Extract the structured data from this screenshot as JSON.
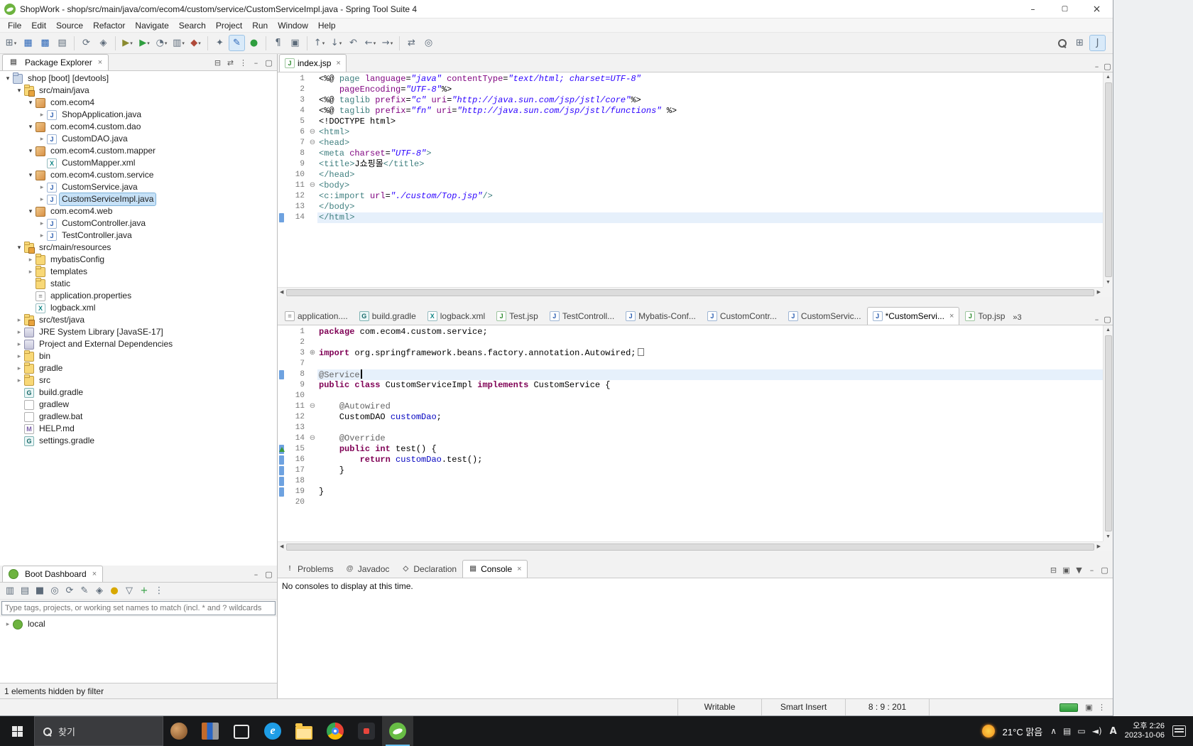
{
  "window": {
    "title": "ShopWork - shop/src/main/java/com/ecom4/custom/service/CustomServiceImpl.java - Spring Tool Suite 4"
  },
  "menu": [
    "File",
    "Edit",
    "Source",
    "Refactor",
    "Navigate",
    "Search",
    "Project",
    "Run",
    "Window",
    "Help"
  ],
  "toolbar": {
    "groups": [
      [
        {
          "n": "new",
          "g": "⊞",
          "caret": true
        },
        {
          "n": "save",
          "g": "▦",
          "c": "g-blue"
        },
        {
          "n": "save-all",
          "g": "▩",
          "c": "g-blue"
        },
        {
          "n": "print",
          "g": "▤"
        }
      ],
      [
        {
          "n": "refresh",
          "g": "⟳"
        },
        {
          "n": "build-all",
          "g": "◈"
        }
      ],
      [
        {
          "n": "debug",
          "g": "▶",
          "c": "g-olive",
          "caret": true
        },
        {
          "n": "run",
          "g": "▶",
          "c": "g-green",
          "caret": true
        },
        {
          "n": "profile",
          "g": "◔",
          "caret": true
        },
        {
          "n": "coverage",
          "g": "▥",
          "caret": true
        },
        {
          "n": "external-tools",
          "g": "◆",
          "c": "g-red",
          "caret": true
        }
      ],
      [
        {
          "n": "new-wizard",
          "g": "✦"
        },
        {
          "n": "mark-occurrences",
          "g": "✎",
          "c": "g-blue",
          "active": true
        },
        {
          "n": "boot-dashboard",
          "g": "●",
          "c": "g-green"
        }
      ],
      [
        {
          "n": "show-whitespace",
          "g": "¶"
        },
        {
          "n": "block-selection",
          "g": "▣"
        }
      ],
      [
        {
          "n": "previous-annotation",
          "g": "↑",
          "caret": true
        },
        {
          "n": "next-annotation",
          "g": "↓",
          "caret": true
        },
        {
          "n": "last-edit-location",
          "g": "↶"
        },
        {
          "n": "back",
          "g": "←",
          "caret": true
        },
        {
          "n": "forward",
          "g": "→",
          "caret": true
        }
      ],
      [
        {
          "n": "link-with-editor",
          "g": "⇄"
        },
        {
          "n": "open-type",
          "g": "◎"
        }
      ]
    ],
    "right": [
      {
        "n": "search"
      },
      {
        "n": "open-perspective",
        "g": "⊞"
      },
      {
        "n": "java-perspective",
        "g": "J",
        "active": true
      }
    ]
  },
  "package_explorer": {
    "title": "Package Explorer",
    "header_icons": [
      {
        "n": "collapse-all",
        "g": "⊟"
      },
      {
        "n": "link-with-editor",
        "g": "⇄"
      },
      {
        "n": "view-menu",
        "g": "⋮"
      },
      {
        "n": "minimize",
        "g": "–"
      },
      {
        "n": "maximize",
        "g": "▢"
      }
    ],
    "tree": [
      {
        "d": 0,
        "a": "o",
        "i": "project",
        "l": "shop [boot] [devtools]"
      },
      {
        "d": 1,
        "a": "o",
        "i": "srcfolder",
        "l": "src/main/java"
      },
      {
        "d": 2,
        "a": "o",
        "i": "package",
        "l": "com.ecom4"
      },
      {
        "d": 3,
        "a": "c",
        "i": "javafile",
        "l": "ShopApplication.java"
      },
      {
        "d": 2,
        "a": "o",
        "i": "package",
        "l": "com.ecom4.custom.dao"
      },
      {
        "d": 3,
        "a": "c",
        "i": "javafile",
        "l": "CustomDAO.java"
      },
      {
        "d": 2,
        "a": "o",
        "i": "package",
        "l": "com.ecom4.custom.mapper"
      },
      {
        "d": 3,
        "i": "xmlfile",
        "l": "CustomMapper.xml"
      },
      {
        "d": 2,
        "a": "o",
        "i": "package",
        "l": "com.ecom4.custom.service"
      },
      {
        "d": 3,
        "a": "c",
        "i": "javafile",
        "l": "CustomService.java"
      },
      {
        "d": 3,
        "a": "c",
        "i": "javafile",
        "l": "CustomServiceImpl.java",
        "sel": true
      },
      {
        "d": 2,
        "a": "o",
        "i": "package",
        "l": "com.ecom4.web"
      },
      {
        "d": 3,
        "a": "c",
        "i": "javafile",
        "l": "CustomController.java"
      },
      {
        "d": 3,
        "a": "c",
        "i": "javafile",
        "l": "TestController.java"
      },
      {
        "d": 1,
        "a": "o",
        "i": "srcfolder",
        "l": "src/main/resources"
      },
      {
        "d": 2,
        "a": "c",
        "i": "folder",
        "l": "mybatisConfig"
      },
      {
        "d": 2,
        "a": "c",
        "i": "folder",
        "l": "templates"
      },
      {
        "d": 2,
        "i": "folder",
        "l": "static"
      },
      {
        "d": 2,
        "i": "propsfile",
        "l": "application.properties"
      },
      {
        "d": 2,
        "i": "xmlfile",
        "l": "logback.xml"
      },
      {
        "d": 1,
        "a": "c",
        "i": "srcfolder",
        "l": "src/test/java"
      },
      {
        "d": 1,
        "a": "c",
        "i": "library",
        "l": "JRE System Library [JavaSE-17]"
      },
      {
        "d": 1,
        "a": "c",
        "i": "library",
        "l": "Project and External Dependencies"
      },
      {
        "d": 1,
        "a": "c",
        "i": "folder",
        "l": "bin"
      },
      {
        "d": 1,
        "a": "c",
        "i": "folder",
        "l": "gradle"
      },
      {
        "d": 1,
        "a": "c",
        "i": "folder",
        "l": "src"
      },
      {
        "d": 1,
        "i": "gradlefile",
        "l": "build.gradle"
      },
      {
        "d": 1,
        "i": "file",
        "l": "gradlew"
      },
      {
        "d": 1,
        "i": "file",
        "l": "gradlew.bat"
      },
      {
        "d": 1,
        "i": "mdfile",
        "l": "HELP.md"
      },
      {
        "d": 1,
        "i": "gradlefile",
        "l": "settings.gradle"
      }
    ]
  },
  "boot_dashboard": {
    "title": "Boot Dashboard",
    "header_icons": [
      {
        "n": "minimize",
        "g": "–"
      },
      {
        "n": "maximize",
        "g": "▢"
      }
    ],
    "toolbar": [
      {
        "n": "start",
        "g": "▥"
      },
      {
        "n": "start-debug",
        "g": "▤"
      },
      {
        "n": "stop",
        "g": "■"
      },
      {
        "n": "open-web-browser",
        "g": "◎"
      },
      {
        "n": "refresh",
        "g": "⟳"
      },
      {
        "n": "edit-config",
        "g": "✎"
      },
      {
        "n": "tag",
        "g": "◈"
      },
      {
        "n": "tips",
        "g": "●",
        "c": "g-yel"
      },
      {
        "n": "filter",
        "g": "▽"
      },
      {
        "n": "add",
        "g": "+",
        "c": "g-green"
      },
      {
        "n": "view-menu",
        "g": "⋮"
      }
    ],
    "filter_placeholder": "Type tags, projects, or working set names to match (incl. * and ? wildcards",
    "items": [
      {
        "label": "local"
      }
    ],
    "footer": "1 elements hidden by filter"
  },
  "editors": {
    "top": {
      "tabs": [
        {
          "i": "jsp",
          "l": "index.jsp",
          "active": true,
          "close": true
        }
      ],
      "lines": [
        {
          "n": 1,
          "s": [
            [
              "p",
              "<%@ "
            ],
            [
              "t",
              "page"
            ],
            [
              "p",
              " "
            ],
            [
              "a",
              "language"
            ],
            [
              "p",
              "="
            ],
            [
              "s",
              "\"java\""
            ],
            [
              "p",
              " "
            ],
            [
              "a",
              "contentType"
            ],
            [
              "p",
              "="
            ],
            [
              "s",
              "\"text/html; charset=UTF-8\""
            ]
          ]
        },
        {
          "n": 2,
          "s": [
            [
              "p",
              "    "
            ],
            [
              "a",
              "pageEncoding"
            ],
            [
              "p",
              "="
            ],
            [
              "s",
              "\"UTF-8\""
            ],
            [
              "p",
              "%>"
            ]
          ]
        },
        {
          "n": 3,
          "s": [
            [
              "p",
              "<%@ "
            ],
            [
              "t",
              "taglib"
            ],
            [
              "p",
              " "
            ],
            [
              "a",
              "prefix"
            ],
            [
              "p",
              "="
            ],
            [
              "s",
              "\"c\""
            ],
            [
              "p",
              " "
            ],
            [
              "a",
              "uri"
            ],
            [
              "p",
              "="
            ],
            [
              "s",
              "\"http://java.sun.com/jsp/jstl/core\""
            ],
            [
              "p",
              "%>"
            ]
          ]
        },
        {
          "n": 4,
          "s": [
            [
              "p",
              "<%@ "
            ],
            [
              "t",
              "taglib"
            ],
            [
              "p",
              " "
            ],
            [
              "a",
              "prefix"
            ],
            [
              "p",
              "="
            ],
            [
              "s",
              "\"fn\""
            ],
            [
              "p",
              " "
            ],
            [
              "a",
              "uri"
            ],
            [
              "p",
              "="
            ],
            [
              "s",
              "\"http://java.sun.com/jsp/jstl/functions\""
            ],
            [
              "p",
              " %>"
            ]
          ]
        },
        {
          "n": 5,
          "s": [
            [
              "p",
              "<!DOCTYPE html>"
            ]
          ]
        },
        {
          "n": 6,
          "f": "-",
          "s": [
            [
              "t",
              "<html>"
            ]
          ]
        },
        {
          "n": 7,
          "f": "-",
          "s": [
            [
              "t",
              "<head>"
            ]
          ]
        },
        {
          "n": 8,
          "s": [
            [
              "t",
              "<meta "
            ],
            [
              "a",
              "charset"
            ],
            [
              "p",
              "="
            ],
            [
              "s",
              "\"UTF-8\""
            ],
            [
              "t",
              ">"
            ]
          ]
        },
        {
          "n": 9,
          "s": [
            [
              "t",
              "<title>"
            ],
            [
              "p",
              "J쇼핑몰"
            ],
            [
              "t",
              "</title>"
            ]
          ]
        },
        {
          "n": 10,
          "s": [
            [
              "t",
              "</head>"
            ]
          ]
        },
        {
          "n": 11,
          "f": "-",
          "s": [
            [
              "t",
              "<body>"
            ]
          ]
        },
        {
          "n": 12,
          "s": [
            [
              "t",
              "<c:import "
            ],
            [
              "a",
              "url"
            ],
            [
              "p",
              "="
            ],
            [
              "s",
              "\"./custom/Top.jsp\""
            ],
            [
              "t",
              "/>"
            ]
          ]
        },
        {
          "n": 13,
          "s": [
            [
              "t",
              "</body>"
            ]
          ]
        },
        {
          "n": 14,
          "m": true,
          "h": true,
          "s": [
            [
              "t",
              "</html>"
            ]
          ]
        }
      ]
    },
    "bottom": {
      "tabs": [
        {
          "i": "propsfile",
          "l": "application...."
        },
        {
          "i": "gradlefile",
          "l": "build.gradle"
        },
        {
          "i": "xmlfile",
          "l": "logback.xml"
        },
        {
          "i": "jsp",
          "l": "Test.jsp"
        },
        {
          "i": "javafile",
          "l": "TestControll..."
        },
        {
          "i": "javafile",
          "l": "Mybatis-Conf..."
        },
        {
          "i": "javafile",
          "l": "CustomContr..."
        },
        {
          "i": "javafile",
          "l": "CustomServic..."
        },
        {
          "i": "javafile",
          "l": "*CustomServi...",
          "active": true,
          "close": true
        },
        {
          "i": "jsp",
          "l": "Top.jsp"
        }
      ],
      "overflow": "»3",
      "lines": [
        {
          "n": 1,
          "s": [
            [
              "k",
              "package"
            ],
            [
              "p",
              " com.ecom4.custom.service;"
            ]
          ]
        },
        {
          "n": 2,
          "s": []
        },
        {
          "n": 3,
          "f": "+",
          "s": [
            [
              "k",
              "import"
            ],
            [
              "p",
              " org.springframework.beans.factory.annotation.Autowired;"
            ],
            [
              "bx",
              ""
            ]
          ]
        },
        {
          "n": 7,
          "s": []
        },
        {
          "n": 8,
          "h": true,
          "m": true,
          "s": [
            [
              "an",
              "@Service"
            ],
            [
              "cur",
              ""
            ]
          ]
        },
        {
          "n": 9,
          "s": [
            [
              "k",
              "public"
            ],
            [
              "p",
              " "
            ],
            [
              "k",
              "class"
            ],
            [
              "p",
              " CustomServiceImpl "
            ],
            [
              "k",
              "implements"
            ],
            [
              "p",
              " CustomService {"
            ]
          ]
        },
        {
          "n": 10,
          "s": []
        },
        {
          "n": 11,
          "f": "-",
          "s": [
            [
              "p",
              "    "
            ],
            [
              "an",
              "@Autowired"
            ]
          ]
        },
        {
          "n": 12,
          "s": [
            [
              "p",
              "    CustomDAO "
            ],
            [
              "fd",
              "customDao"
            ],
            [
              "p",
              ";"
            ]
          ]
        },
        {
          "n": 13,
          "s": []
        },
        {
          "n": 14,
          "f": "-",
          "s": [
            [
              "p",
              "    "
            ],
            [
              "an",
              "@Override"
            ]
          ]
        },
        {
          "n": 15,
          "m": true,
          "t": true,
          "s": [
            [
              "p",
              "    "
            ],
            [
              "k",
              "public"
            ],
            [
              "p",
              " "
            ],
            [
              "k",
              "int"
            ],
            [
              "p",
              " test() {"
            ]
          ]
        },
        {
          "n": 16,
          "m": true,
          "s": [
            [
              "p",
              "        "
            ],
            [
              "k",
              "return"
            ],
            [
              "p",
              " "
            ],
            [
              "fd",
              "customDao"
            ],
            [
              "p",
              ".test();"
            ]
          ]
        },
        {
          "n": 17,
          "m": true,
          "s": [
            [
              "p",
              "    }"
            ]
          ]
        },
        {
          "n": 18,
          "m": true,
          "s": []
        },
        {
          "n": 19,
          "m": true,
          "s": [
            [
              "p",
              "}"
            ]
          ]
        },
        {
          "n": 20,
          "s": []
        }
      ]
    }
  },
  "console": {
    "tabs": [
      {
        "i": "problems",
        "l": "Problems"
      },
      {
        "i": "at",
        "l": "Javadoc"
      },
      {
        "i": "decl",
        "l": "Declaration"
      },
      {
        "i": "console",
        "l": "Console",
        "active": true,
        "close": true
      }
    ],
    "right_icons": [
      {
        "n": "pin-console",
        "g": "⊟"
      },
      {
        "n": "display-selected-console",
        "g": "▣"
      },
      {
        "n": "open-console",
        "g": "▼"
      },
      {
        "n": "minimize",
        "g": "–"
      },
      {
        "n": "maximize",
        "g": "▢"
      }
    ],
    "message": "No consoles to display at this time."
  },
  "statusbar": {
    "cells": [
      "Writable",
      "Smart Insert",
      "8 : 9 : 201"
    ],
    "icons": [
      {
        "n": "gc",
        "g": "▣"
      },
      {
        "n": "progress-menu",
        "g": "⋮"
      }
    ]
  },
  "taskbar": {
    "search_label": "찾기",
    "apps": [
      {
        "n": "user-avatar"
      },
      {
        "n": "books-app"
      },
      {
        "n": "task-view"
      },
      {
        "n": "edge-browser"
      },
      {
        "n": "file-explorer"
      },
      {
        "n": "chrome-browser"
      },
      {
        "n": "pinned-app"
      },
      {
        "n": "spring-tool-suite",
        "active": true
      }
    ],
    "tray": {
      "weather": "21°C 맑음",
      "icons": [
        {
          "n": "hidden-icons-chevron",
          "g": "∧"
        },
        {
          "n": "tray-app",
          "g": "▤"
        },
        {
          "n": "tray-display",
          "g": "▭"
        },
        {
          "n": "volume",
          "g": "◄)"
        }
      ],
      "ime": "A",
      "time": "오후 2:26",
      "date": "2023-10-06"
    }
  }
}
